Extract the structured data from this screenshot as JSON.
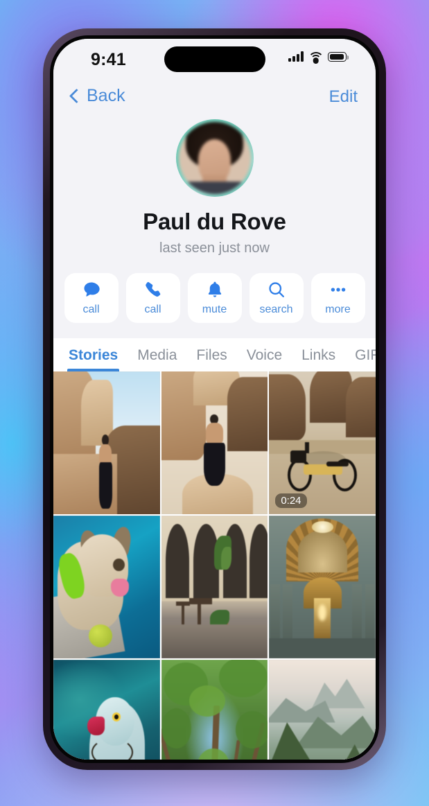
{
  "status_bar": {
    "time": "9:41",
    "icons": [
      "cellular-signal-icon",
      "wifi-icon",
      "battery-icon"
    ]
  },
  "nav_bar": {
    "back_label": "Back",
    "back_icon": "chevron-left-icon",
    "edit_label": "Edit"
  },
  "profile": {
    "avatar_name": "avatar",
    "name": "Paul du Rove",
    "status": "last seen just now",
    "has_story_ring": true,
    "story_ring_color": "#6fc9b8"
  },
  "actions": [
    {
      "icon": "chat-bubble-icon",
      "label": "call"
    },
    {
      "icon": "phone-icon",
      "label": "call"
    },
    {
      "icon": "bell-icon",
      "label": "mute"
    },
    {
      "icon": "search-icon",
      "label": "search"
    },
    {
      "icon": "more-dots-icon",
      "label": "more"
    }
  ],
  "tabs": [
    {
      "label": "Stories",
      "active": true
    },
    {
      "label": "Media",
      "active": false
    },
    {
      "label": "Files",
      "active": false
    },
    {
      "label": "Voice",
      "active": false
    },
    {
      "label": "Links",
      "active": false
    },
    {
      "label": "GIFs",
      "active": false
    }
  ],
  "grid": {
    "columns": 3,
    "tiles": [
      {
        "name": "tile-canyon-person",
        "description": "man standing in desert canyon",
        "duration": ""
      },
      {
        "name": "tile-desert-rock-pose",
        "description": "man posing on desert rock",
        "duration": ""
      },
      {
        "name": "tile-desert-motorbike",
        "description": "motorbike in desert landscape",
        "duration": "0:24"
      },
      {
        "name": "tile-dog-pool",
        "description": "french bulldog beside pool",
        "duration": ""
      },
      {
        "name": "tile-street-cafe",
        "description": "old town street cafe arcade",
        "duration": ""
      },
      {
        "name": "tile-basilica-dome",
        "description": "basilica dome interior",
        "duration": ""
      },
      {
        "name": "tile-parrot",
        "description": "parrot on teal fabric",
        "duration": ""
      },
      {
        "name": "tile-forest-canopy",
        "description": "tree canopy from below",
        "duration": ""
      },
      {
        "name": "tile-mountain-valley",
        "description": "misty mountain valley",
        "duration": ""
      }
    ]
  },
  "colors": {
    "accent": "#3b86d8",
    "link": "#4a8bd8",
    "icon_blue": "#2f7ee8",
    "screen_bg": "#f3f3f7",
    "muted_text": "#8b9099"
  }
}
